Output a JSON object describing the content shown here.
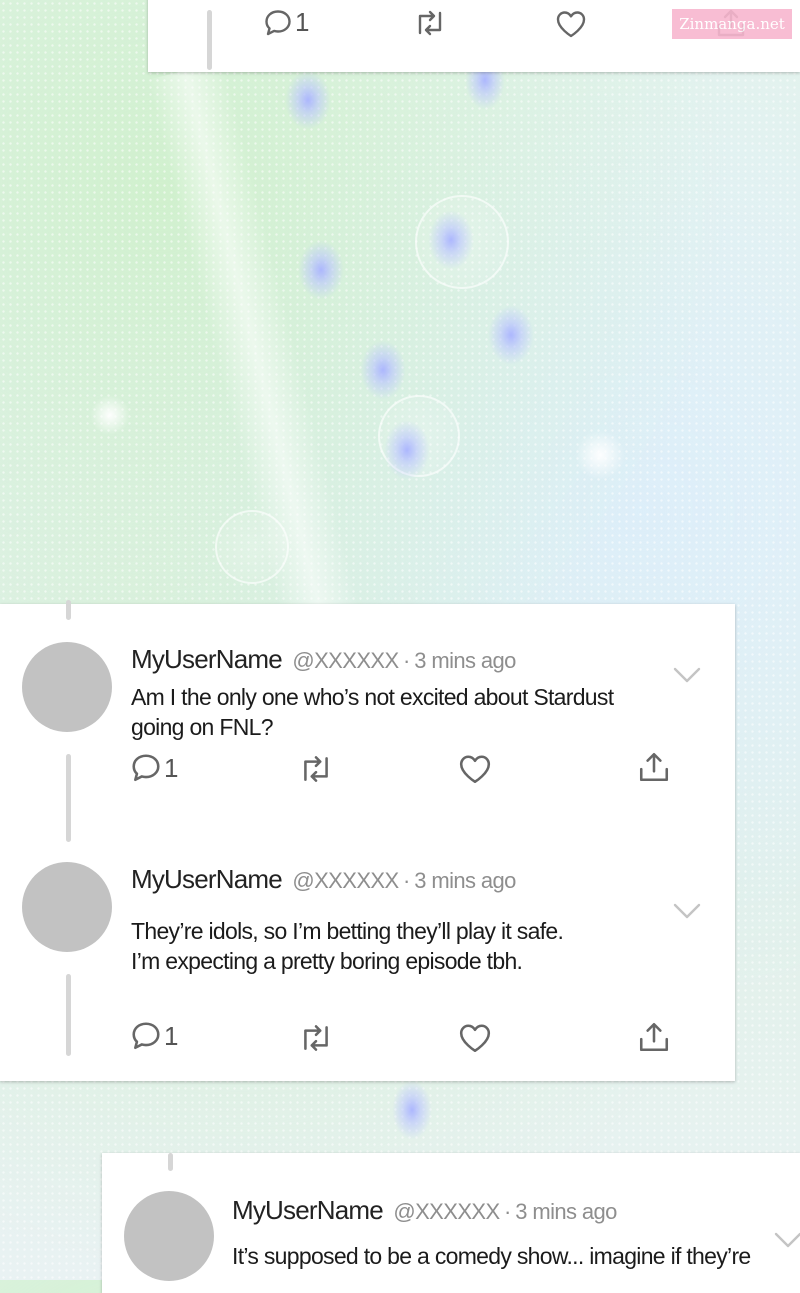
{
  "watermark": "Zinmanga.net",
  "top_card": {
    "reply_count": "1"
  },
  "tweets": [
    {
      "username": "MyUserName",
      "handle": "@XXXXXX",
      "separator": "·",
      "time": "3 mins ago",
      "lines": [
        "Am I the only one who’s not excited about Stardust",
        "going on FNL?"
      ],
      "reply_count": "1"
    },
    {
      "username": "MyUserName",
      "handle": "@XXXXXX",
      "separator": "·",
      "time": "3 mins ago",
      "lines": [
        "They’re idols, so I’m betting they’ll play it safe.",
        "I’m expecting a pretty boring episode tbh."
      ],
      "reply_count": "1"
    },
    {
      "username": "MyUserName",
      "handle": "@XXXXXX",
      "separator": "·",
      "time": "3 mins ago",
      "lines": [
        "It’s supposed to be a comedy show... imagine if they’re"
      ]
    }
  ],
  "icons": {
    "reply": "reply-icon",
    "retweet": "retweet-icon",
    "like": "heart-icon",
    "share": "share-icon",
    "more": "chevron-down-icon"
  }
}
